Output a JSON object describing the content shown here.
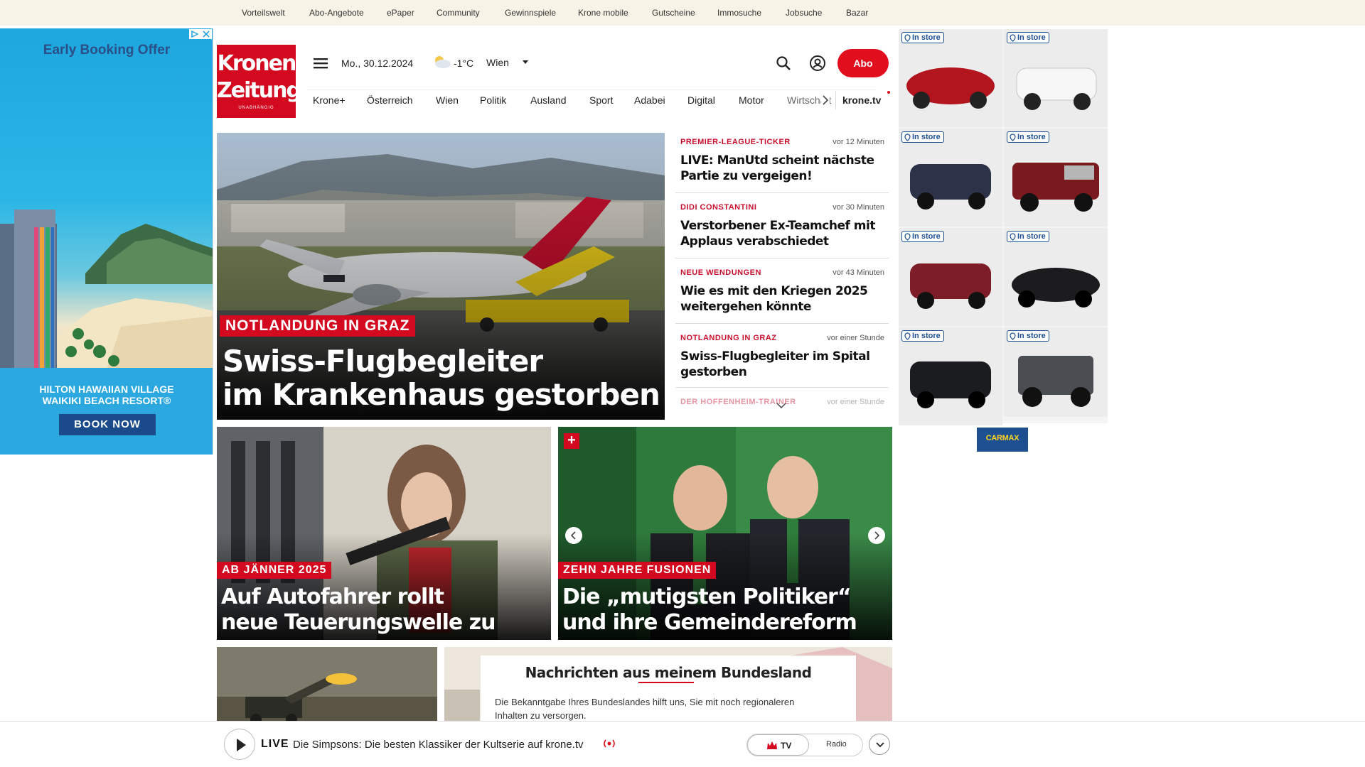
{
  "topnav": [
    "Vorteilswelt",
    "Abo-Angebote",
    "ePaper",
    "Community",
    "Gewinnspiele",
    "Krone mobile",
    "Gutscheine",
    "Immosuche",
    "Jobsuche",
    "Bazar"
  ],
  "left_ad": {
    "headline": "Early Booking Offer",
    "hotel_line1": "HILTON HAWAIIAN VILLAGE",
    "hotel_line2": "WAIKIKI BEACH RESORT®",
    "cta": "BOOK NOW"
  },
  "header": {
    "logo_line1": "Kronen",
    "logo_line2": "Zeitung",
    "logo_sub": "UNABHÄNGIG",
    "date": "Mo., 30.12.2024",
    "temperature": "-1°C",
    "location": "Wien",
    "abo_label": "Abo",
    "nav": [
      "Krone+",
      "Österreich",
      "Wien",
      "Politik",
      "Ausland",
      "Sport",
      "Adabei",
      "Digital",
      "Motor",
      "Wirtschaft"
    ],
    "tv_link": "krone.tv"
  },
  "hero": {
    "kicker": "NOTLANDUNG IN GRAZ",
    "title_line1": "Swiss-Flugbegleiter",
    "title_line2": "im Krankenhaus gestorben"
  },
  "ticker": [
    {
      "kicker": "PREMIER-LEAGUE-TICKER",
      "time": "vor 12 Minuten",
      "title": "LIVE: ManUtd scheint nächste Partie zu vergeigen!"
    },
    {
      "kicker": "DIDI CONSTANTINI",
      "time": "vor 30 Minuten",
      "title": "Verstorbener Ex-Teamchef mit Applaus verabschiedet"
    },
    {
      "kicker": "NEUE WENDUNGEN",
      "time": "vor 43 Minuten",
      "title": "Wie es mit den Kriegen 2025 weitergehen könnte"
    },
    {
      "kicker": "NOTLANDUNG IN GRAZ",
      "time": "vor einer Stunde",
      "title": "Swiss-Flugbegleiter im Spital gestorben"
    },
    {
      "kicker": "DER HOFFENHEIM-TRAINER",
      "time": "vor einer Stunde",
      "title": ""
    }
  ],
  "teasers": [
    {
      "kicker": "AB JÄNNER 2025",
      "title_line1": "Auf Autofahrer rollt",
      "title_line2": "neue Teuerungswelle zu"
    },
    {
      "kicker": "ZEHN JAHRE FUSIONEN",
      "title_line1": "Die „mutigsten Politiker“",
      "title_line2": "und ihre Gemeindereform"
    }
  ],
  "bundesland": {
    "title": "Nachrichten aus meinem Bundesland",
    "text_line1": "Die Bekanntgabe Ihres Bundeslandes hilft uns, Sie mit noch regionaleren",
    "text_line2": "Inhalten zu versorgen."
  },
  "right_ad": {
    "badge": "In store",
    "brand": "CARMAX",
    "cars": [
      "red convertible",
      "white suv",
      "dark blue suv",
      "red pickup",
      "red suv",
      "black convertible",
      "black suv",
      "gray jeep"
    ]
  },
  "livebar": {
    "live_label": "LIVE",
    "text": "Die Simpsons: Die besten Klassiker der Kultserie auf krone.tv",
    "tv_label": "TV",
    "radio_label": "Radio"
  },
  "colors": {
    "brand_red": "#d2091f",
    "topbar_bg": "#f7f3e6",
    "instore_blue": "#1d4f91"
  }
}
